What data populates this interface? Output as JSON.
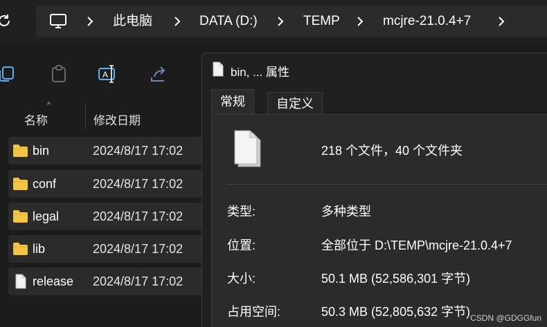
{
  "address_bar": {
    "segments": [
      "此电脑",
      "DATA (D:)",
      "TEMP",
      "mcjre-21.0.4+7"
    ]
  },
  "toolbar": {
    "icons": [
      "copy-icon",
      "paste-icon",
      "rename-icon",
      "share-icon"
    ]
  },
  "file_list": {
    "columns": {
      "name": "名称",
      "date_modified": "修改日期"
    },
    "rows": [
      {
        "name": "bin",
        "date": "2024/8/17 17:02",
        "type": "folder"
      },
      {
        "name": "conf",
        "date": "2024/8/17 17:02",
        "type": "folder"
      },
      {
        "name": "legal",
        "date": "2024/8/17 17:02",
        "type": "folder"
      },
      {
        "name": "lib",
        "date": "2024/8/17 17:02",
        "type": "folder"
      },
      {
        "name": "release",
        "date": "2024/8/17 17:02",
        "type": "file"
      }
    ]
  },
  "properties_dialog": {
    "title": "bin, ... 属性",
    "tabs": {
      "general": "常规",
      "custom": "自定义"
    },
    "summary": "218 个文件，40 个文件夹",
    "properties": [
      {
        "label": "类型:",
        "value": "多种类型"
      },
      {
        "label": "位置:",
        "value": "全部位于 D:\\TEMP\\mcjre-21.0.4+7"
      },
      {
        "label": "大小:",
        "value": "50.1 MB (52,586,301 字节)"
      },
      {
        "label": "占用空间:",
        "value": "50.3 MB (52,805,632 字节)"
      }
    ]
  },
  "watermark": "CSDN @GDGGfun",
  "colors": {
    "background": "#1c1c1c",
    "panel": "#2b2b2b",
    "folder_yellow": "#f4c542",
    "text": "#ffffff"
  }
}
